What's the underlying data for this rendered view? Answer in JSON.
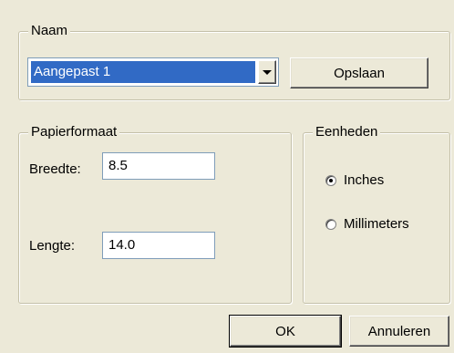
{
  "naam": {
    "legend": "Naam",
    "combo_value": "Aangepast 1",
    "save_label": "Opslaan"
  },
  "paper": {
    "legend": "Papierformaat",
    "width_label": "Breedte:",
    "width_value": "8.5",
    "length_label": "Lengte:",
    "length_value": "14.0"
  },
  "units": {
    "legend": "Eenheden",
    "options": [
      {
        "label": "Inches",
        "selected": true
      },
      {
        "label": "Millimeters",
        "selected": false
      }
    ]
  },
  "footer": {
    "ok_label": "OK",
    "cancel_label": "Annuleren"
  }
}
